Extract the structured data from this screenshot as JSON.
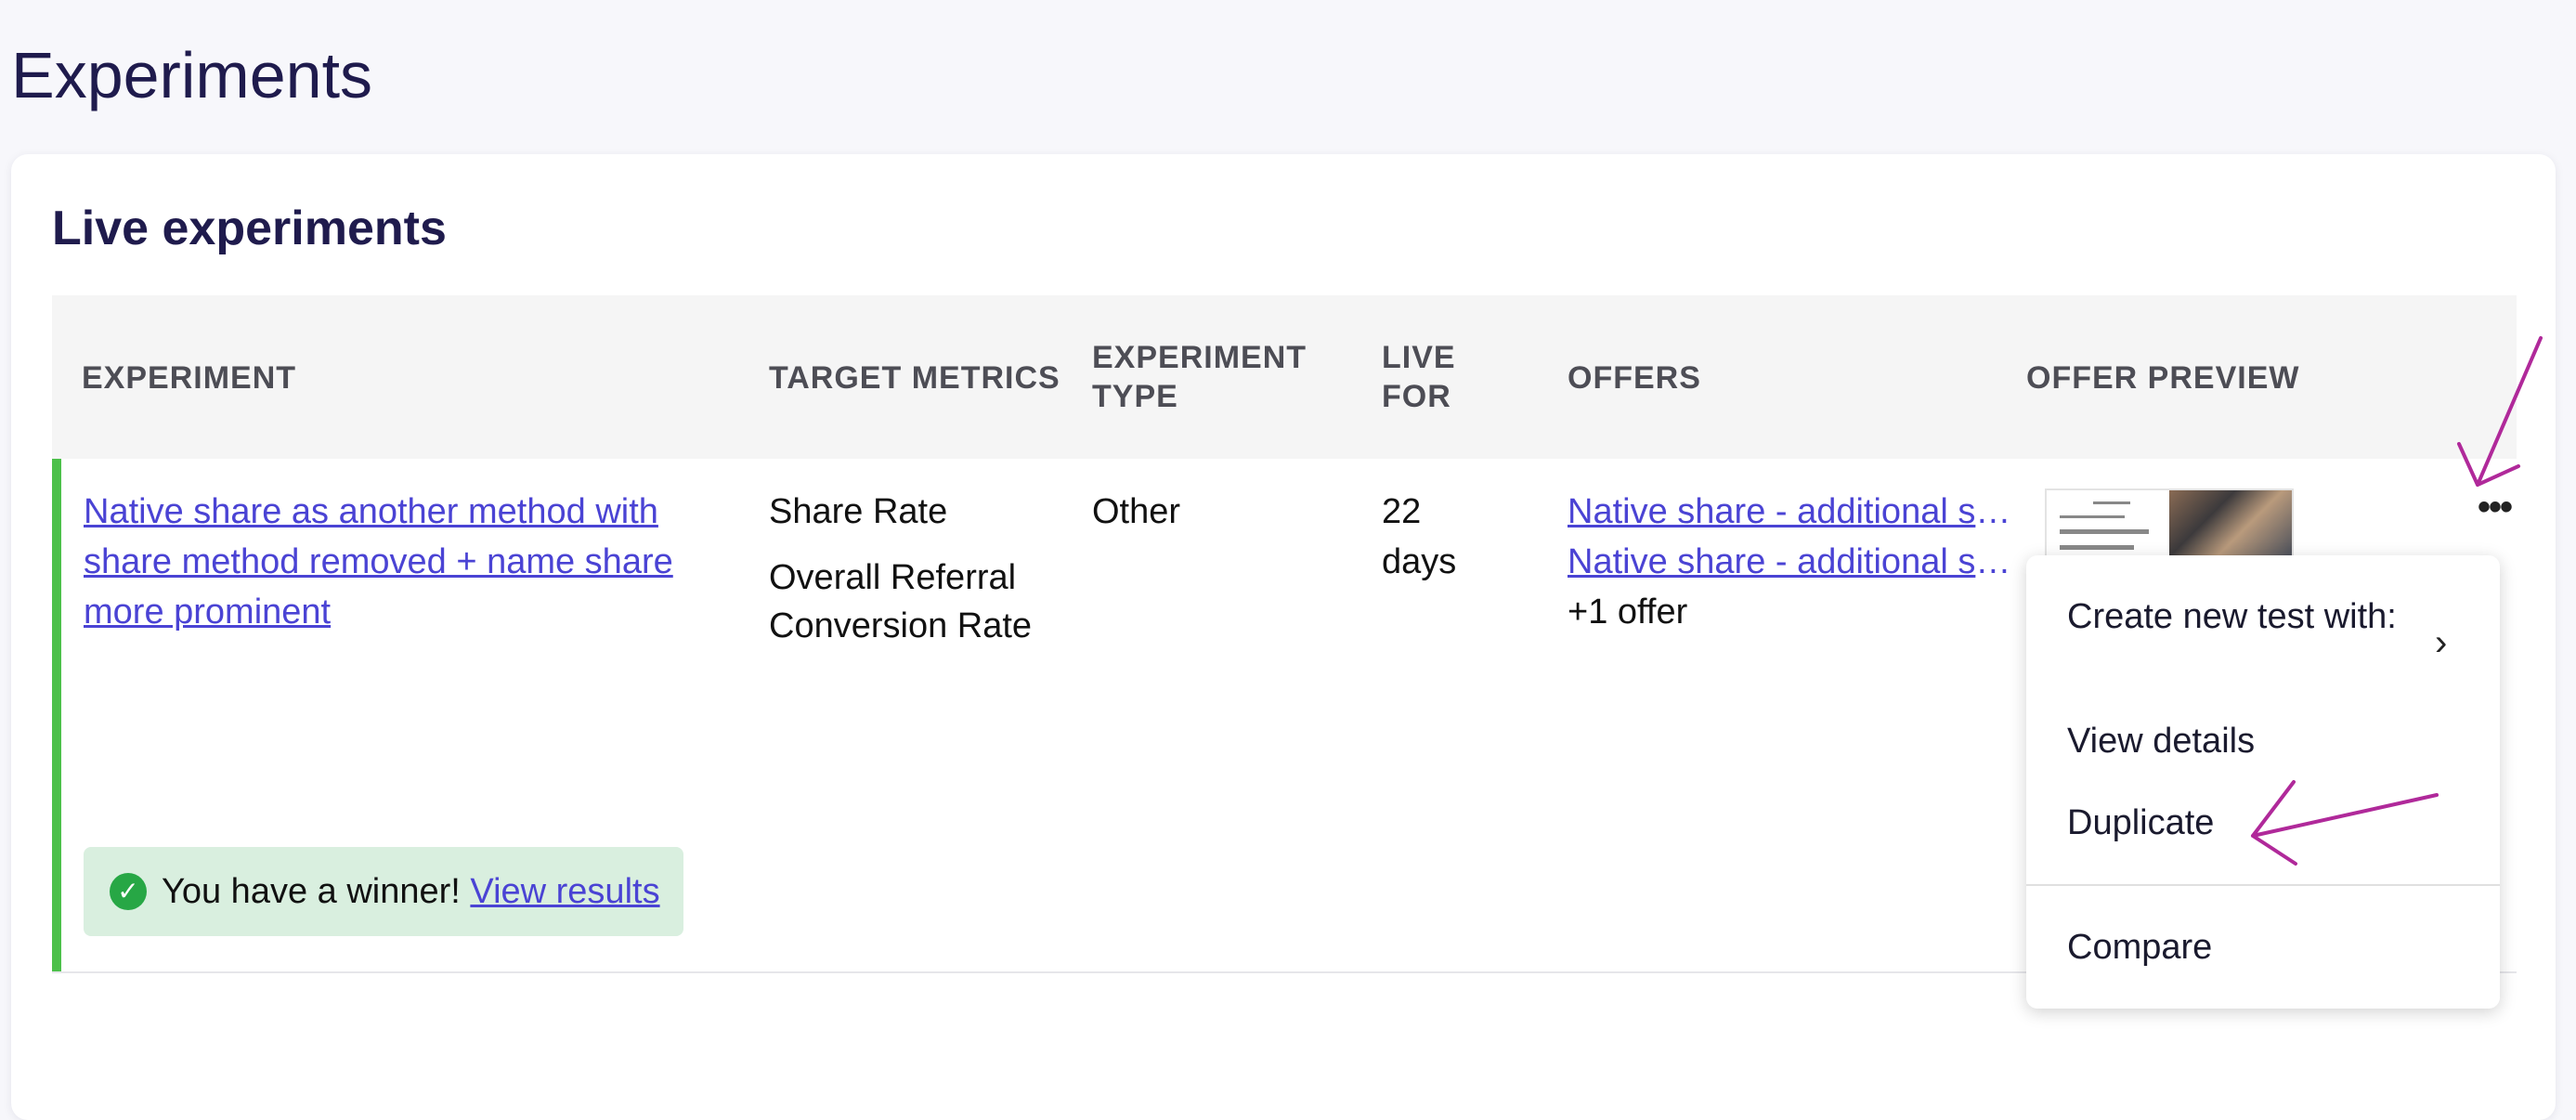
{
  "page": {
    "title": "Experiments"
  },
  "live": {
    "section_title": "Live experiments",
    "headers": {
      "experiment": "EXPERIMENT",
      "target_metrics": "TARGET METRICS",
      "experiment_type_l1": "EXPERIMENT",
      "experiment_type_l2": "TYPE",
      "live_for_l1": "LIVE",
      "live_for_l2": "FOR",
      "offers": "OFFERS",
      "offer_preview": "OFFER PREVIEW"
    },
    "row": {
      "experiment_name": "Native share as another method with share method removed + name share more prominent",
      "metric_1": "Share Rate",
      "metric_2": "Overall Referral Conversion Rate",
      "type": "Other",
      "live_for_l1": "22",
      "live_for_l2": "days",
      "offer_1": "Native share - additional share method",
      "offer_2": "Native share - additional share method",
      "offer_more": "+1 offer",
      "winner_text": "You have a winner!",
      "winner_link": "View results",
      "more_button": "•••"
    },
    "menu": {
      "create": "Create new test with:",
      "chevron": "›",
      "view_details": "View details",
      "duplicate": "Duplicate",
      "compare": "Compare"
    }
  },
  "colors": {
    "accent_green": "#4cc04a",
    "link": "#4a43d4",
    "annotation": "#b0299a",
    "winner_bg": "#d9efdf"
  },
  "icons": {
    "winner": "check-circle-icon",
    "menu_chevron": "chevron-right-icon",
    "more": "more-horizontal-icon"
  }
}
